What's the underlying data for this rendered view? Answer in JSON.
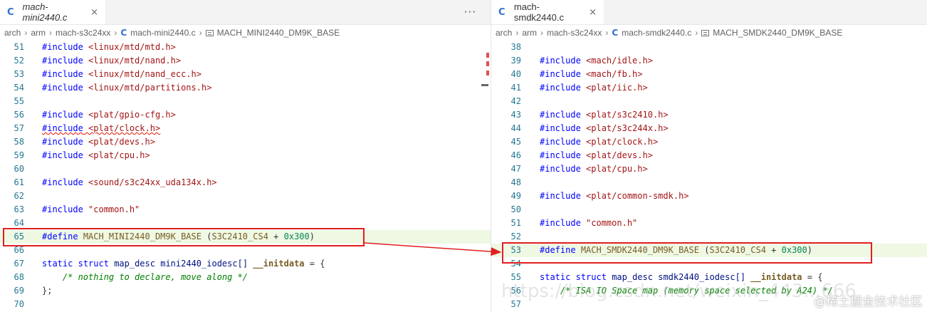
{
  "left": {
    "tab": {
      "name": "mach-mini2440.c",
      "close": "×"
    },
    "more": "···",
    "breadcrumb": [
      "arch",
      "arm",
      "mach-s3c24xx",
      "mach-mini2440.c",
      "MACH_MINI2440_DM9K_BASE"
    ],
    "lines": [
      {
        "n": "51",
        "t": "#include <linux/mtd/mtd.h>"
      },
      {
        "n": "52",
        "t": "#include <linux/mtd/nand.h>"
      },
      {
        "n": "53",
        "t": "#include <linux/mtd/nand_ecc.h>"
      },
      {
        "n": "54",
        "t": "#include <linux/mtd/partitions.h>"
      },
      {
        "n": "55",
        "t": ""
      },
      {
        "n": "56",
        "t": "#include <plat/gpio-cfg.h>"
      },
      {
        "n": "57",
        "t": "#include <plat/clock.h>"
      },
      {
        "n": "58",
        "t": "#include <plat/devs.h>"
      },
      {
        "n": "59",
        "t": "#include <plat/cpu.h>"
      },
      {
        "n": "60",
        "t": ""
      },
      {
        "n": "61",
        "t": "#include <sound/s3c24xx_uda134x.h>"
      },
      {
        "n": "62",
        "t": ""
      },
      {
        "n": "63",
        "t": "#include \"common.h\""
      },
      {
        "n": "64",
        "t": ""
      },
      {
        "n": "65",
        "t": "#define MACH_MINI2440_DM9K_BASE (S3C2410_CS4 + 0x300)"
      },
      {
        "n": "66",
        "t": ""
      },
      {
        "n": "67",
        "t": "static struct map_desc mini2440_iodesc[] __initdata = {"
      },
      {
        "n": "68",
        "t": "    /* nothing to declare, move along */"
      },
      {
        "n": "69",
        "t": "};"
      },
      {
        "n": "70",
        "t": ""
      }
    ]
  },
  "right": {
    "tab": {
      "name": "mach-smdk2440.c",
      "close": "×"
    },
    "breadcrumb": [
      "arch",
      "arm",
      "mach-s3c24xx",
      "mach-smdk2440.c",
      "MACH_SMDK2440_DM9K_BASE"
    ],
    "lines": [
      {
        "n": "38",
        "t": ""
      },
      {
        "n": "39",
        "t": "#include <mach/idle.h>"
      },
      {
        "n": "40",
        "t": "#include <mach/fb.h>"
      },
      {
        "n": "41",
        "t": "#include <plat/iic.h>"
      },
      {
        "n": "42",
        "t": ""
      },
      {
        "n": "43",
        "t": "#include <plat/s3c2410.h>"
      },
      {
        "n": "44",
        "t": "#include <plat/s3c244x.h>"
      },
      {
        "n": "45",
        "t": "#include <plat/clock.h>"
      },
      {
        "n": "46",
        "t": "#include <plat/devs.h>"
      },
      {
        "n": "47",
        "t": "#include <plat/cpu.h>"
      },
      {
        "n": "48",
        "t": ""
      },
      {
        "n": "49",
        "t": "#include <plat/common-smdk.h>"
      },
      {
        "n": "50",
        "t": ""
      },
      {
        "n": "51",
        "t": "#include \"common.h\""
      },
      {
        "n": "52",
        "t": ""
      },
      {
        "n": "53",
        "t": "#define MACH_SMDK2440_DM9K_BASE (S3C2410_CS4 + 0x300)"
      },
      {
        "n": "54",
        "t": ""
      },
      {
        "n": "55",
        "t": "static struct map_desc smdk2440_iodesc[] __initdata = {"
      },
      {
        "n": "56",
        "t": "    /* ISA IO Space map (memory space selected by A24) */"
      },
      {
        "n": "57",
        "t": ""
      }
    ]
  },
  "watermark": "@稀土掘金技术社区",
  "url_watermark": "https://blog.csdn.net/weixin_443...666"
}
